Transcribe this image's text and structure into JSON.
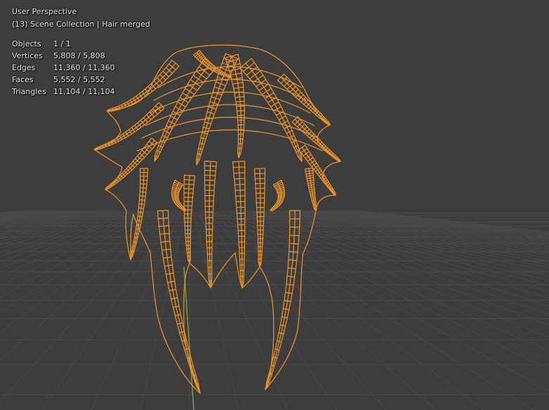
{
  "viewport": {
    "view_name": "User Perspective",
    "collection_line": "(13) Scene Collection | Hair merged",
    "stats": [
      {
        "label": "Objects",
        "value": "1 / 1"
      },
      {
        "label": "Vertices",
        "value": "5,808 / 5,808"
      },
      {
        "label": "Edges",
        "value": "11,360 / 11,360"
      },
      {
        "label": "Faces",
        "value": "5,552 / 5,552"
      },
      {
        "label": "Triangles",
        "value": "11,104 / 11,104"
      }
    ]
  },
  "colors": {
    "background": "#3d3d3d",
    "grid": "#4a4a4a",
    "wire": "#f0952a",
    "y_axis": "#7d9a45"
  }
}
